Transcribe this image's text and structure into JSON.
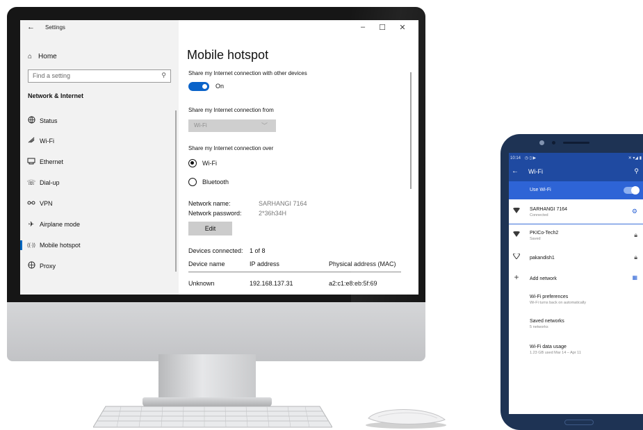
{
  "settings": {
    "window_title": "Settings",
    "back_glyph": "←",
    "controls": {
      "minimize": "–",
      "maximize": "☐",
      "close": "✕"
    },
    "home_label": "Home",
    "search_placeholder": "Find a setting",
    "section_title": "Network & Internet",
    "nav": [
      {
        "label": "Status",
        "icon": "globe-icon",
        "glyph": "🌐"
      },
      {
        "label": "Wi-Fi",
        "icon": "wifi-icon",
        "glyph": "ᯤ"
      },
      {
        "label": "Ethernet",
        "icon": "ethernet-icon",
        "glyph": "⊟"
      },
      {
        "label": "Dial-up",
        "icon": "dialup-icon",
        "glyph": "☏"
      },
      {
        "label": "VPN",
        "icon": "vpn-icon",
        "glyph": "⚯"
      },
      {
        "label": "Airplane mode",
        "icon": "airplane-icon",
        "glyph": "✈"
      },
      {
        "label": "Mobile hotspot",
        "icon": "hotspot-icon",
        "glyph": "((·))"
      },
      {
        "label": "Proxy",
        "icon": "proxy-globe-icon",
        "glyph": "⊕"
      }
    ],
    "active_nav": "Mobile hotspot",
    "page_title": "Mobile hotspot",
    "share_label": "Share my Internet connection with other devices",
    "toggle_state": "On",
    "share_from_label": "Share my Internet connection from",
    "share_from_value": "Wi-Fi",
    "share_over_label": "Share my Internet connection over",
    "share_over_options": [
      "Wi-Fi",
      "Bluetooth"
    ],
    "share_over_selected": "Wi-Fi",
    "network_name_label": "Network name:",
    "network_name_value": "SARHANGI 7164",
    "network_password_label": "Network password:",
    "network_password_value": "2*36h34H",
    "edit_button": "Edit",
    "devices_connected_label": "Devices connected:",
    "devices_connected_value": "1 of 8",
    "table_headers": [
      "Device name",
      "IP address",
      "Physical address (MAC)"
    ],
    "table_rows": [
      [
        "Unknown",
        "192.168.137.31",
        "a2:c1:e8:eb:5f:69"
      ]
    ]
  },
  "phone": {
    "status_time": "10:14",
    "status_icons_left": "◷ ▯ ▶",
    "status_icons_right": "✕ ▾◢ ▮",
    "title": "Wi-Fi",
    "use_wifi_label": "Use Wi-Fi",
    "use_wifi_on": true,
    "networks": [
      {
        "name": "SARHANGI 7164",
        "status": "Connected",
        "trail": "gear-icon"
      },
      {
        "name": "PKICo-Tech2",
        "status": "Saved",
        "trail": "lock-icon"
      },
      {
        "name": "pakandish1",
        "status": "",
        "trail": "lock-icon"
      }
    ],
    "add_network": "Add network",
    "preferences": [
      {
        "title": "Wi-Fi preferences",
        "subtitle": "Wi-Fi turns back on automatically"
      },
      {
        "title": "Saved networks",
        "subtitle": "5 networks"
      },
      {
        "title": "Wi-Fi data usage",
        "subtitle": "1.23 GB used Mar 14 – Apr 11"
      }
    ]
  },
  "colors": {
    "windows_accent": "#0a63c9",
    "android_header": "#1f4aa1",
    "android_usewifi": "#2e64d6",
    "phone_body": "#1e3354"
  }
}
